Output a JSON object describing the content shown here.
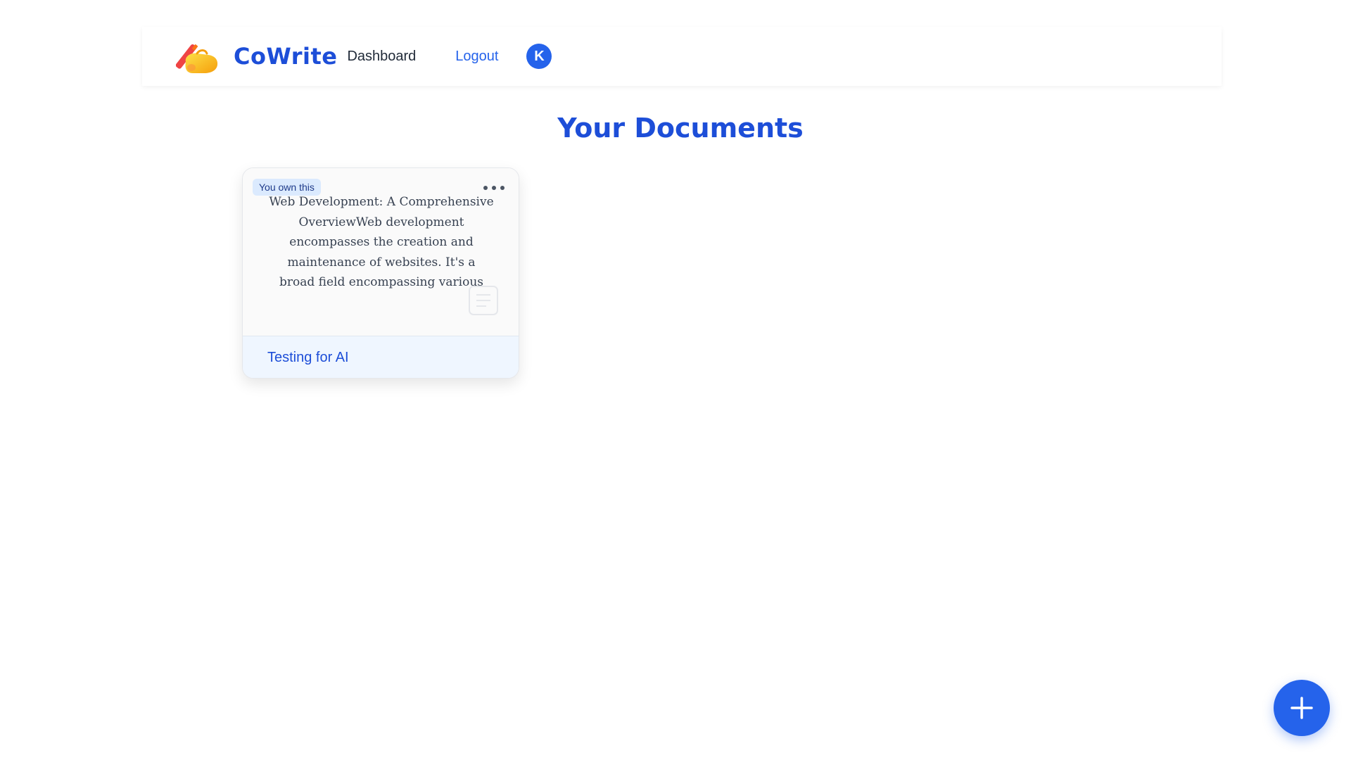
{
  "nav": {
    "brand": "CoWrite",
    "logo_icon": "writing-hand-icon",
    "dashboard_label": "Dashboard",
    "logout_label": "Logout",
    "avatar_initial": "K"
  },
  "main": {
    "title": "Your Documents",
    "documents": [
      {
        "badge": "You own this",
        "preview": "Web Development: A Comprehensive OverviewWeb development encompasses the creation and maintenance of websites. It's a broad field encompassing various skills an...",
        "title": "Testing for AI",
        "menu_icon": "more-horizontal-icon",
        "doc_icon": "document-icon"
      }
    ]
  },
  "fab": {
    "icon": "plus-icon"
  },
  "colors": {
    "primary": "#2563eb",
    "brand": "#1d4ed8",
    "badge_bg": "#dbeafe",
    "footer_bg": "#eff6ff"
  }
}
